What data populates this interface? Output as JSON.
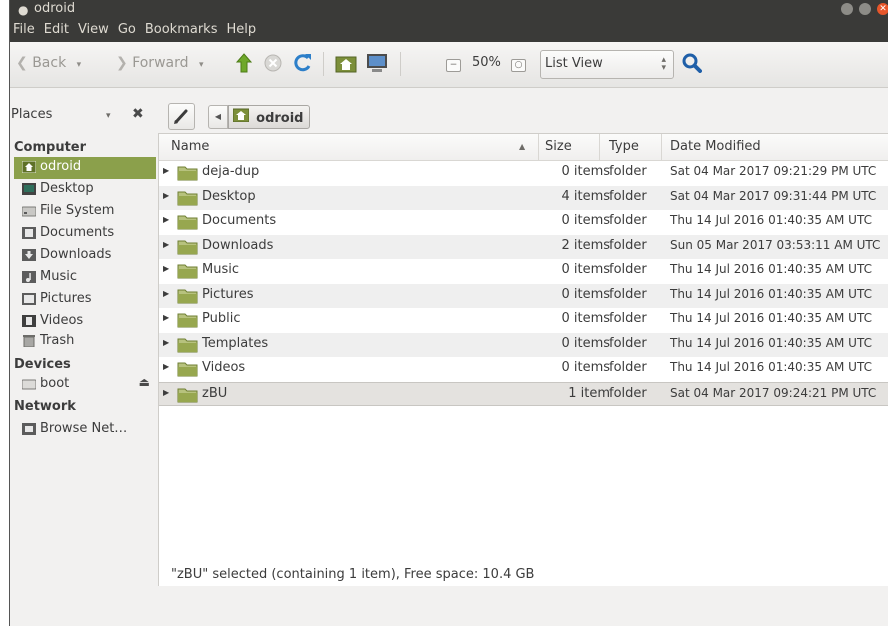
{
  "window": {
    "title": "odroid",
    "title_dot": "●"
  },
  "menubar": [
    "File",
    "Edit",
    "View",
    "Go",
    "Bookmarks",
    "Help"
  ],
  "toolbar": {
    "back_label": "Back",
    "forward_label": "Forward",
    "zoom_level": "50%",
    "view_mode": "List View",
    "dropdown_glyph": "▾"
  },
  "locationbar": {
    "places_label": "Places",
    "close_glyph": "✖",
    "crumb_label": "odroid"
  },
  "sidebar": {
    "sections": {
      "computer": "Computer",
      "devices": "Devices",
      "network": "Network"
    },
    "computer_items": [
      {
        "label": "odroid",
        "icon": "home-folder-icon",
        "selected": true
      },
      {
        "label": "Desktop",
        "icon": "desktop-icon"
      },
      {
        "label": "File System",
        "icon": "drive-icon"
      },
      {
        "label": "Documents",
        "icon": "documents-icon"
      },
      {
        "label": "Downloads",
        "icon": "downloads-icon"
      },
      {
        "label": "Music",
        "icon": "music-icon"
      },
      {
        "label": "Pictures",
        "icon": "pictures-icon"
      },
      {
        "label": "Videos",
        "icon": "videos-icon"
      },
      {
        "label": "Trash",
        "icon": "trash-icon"
      }
    ],
    "device_items": [
      {
        "label": "boot",
        "icon": "drive-icon",
        "eject": "⏏"
      }
    ],
    "network_items": [
      {
        "label": "Browse Net…",
        "icon": "network-icon"
      }
    ]
  },
  "table": {
    "columns": {
      "name": "Name",
      "size": "Size",
      "type": "Type",
      "date": "Date Modified"
    },
    "sort_glyph": "▲",
    "rows": [
      {
        "name": "deja-dup",
        "size": "0 items",
        "type": "folder",
        "date": "Sat 04 Mar 2017 09:21:29 PM UTC"
      },
      {
        "name": "Desktop",
        "size": "4 items",
        "type": "folder",
        "date": "Sat 04 Mar 2017 09:31:44 PM UTC"
      },
      {
        "name": "Documents",
        "size": "0 items",
        "type": "folder",
        "date": "Thu 14 Jul 2016 01:40:35 AM UTC"
      },
      {
        "name": "Downloads",
        "size": "2 items",
        "type": "folder",
        "date": "Sun 05 Mar 2017 03:53:11 AM UTC"
      },
      {
        "name": "Music",
        "size": "0 items",
        "type": "folder",
        "date": "Thu 14 Jul 2016 01:40:35 AM UTC"
      },
      {
        "name": "Pictures",
        "size": "0 items",
        "type": "folder",
        "date": "Thu 14 Jul 2016 01:40:35 AM UTC"
      },
      {
        "name": "Public",
        "size": "0 items",
        "type": "folder",
        "date": "Thu 14 Jul 2016 01:40:35 AM UTC"
      },
      {
        "name": "Templates",
        "size": "0 items",
        "type": "folder",
        "date": "Thu 14 Jul 2016 01:40:35 AM UTC"
      },
      {
        "name": "Videos",
        "size": "0 items",
        "type": "folder",
        "date": "Thu 14 Jul 2016 01:40:35 AM UTC"
      },
      {
        "name": "zBU",
        "size": "1 item",
        "type": "folder",
        "date": "Sat 04 Mar 2017 09:24:21 PM UTC",
        "selected": true
      }
    ]
  },
  "status": {
    "text": "\"zBU\" selected (containing 1 item), Free space: 10.4 GB"
  },
  "colors": {
    "accent": "#8ba04b",
    "titlebar": "#3a3a38",
    "close": "#e7562a",
    "folder": "#9aab5e"
  }
}
